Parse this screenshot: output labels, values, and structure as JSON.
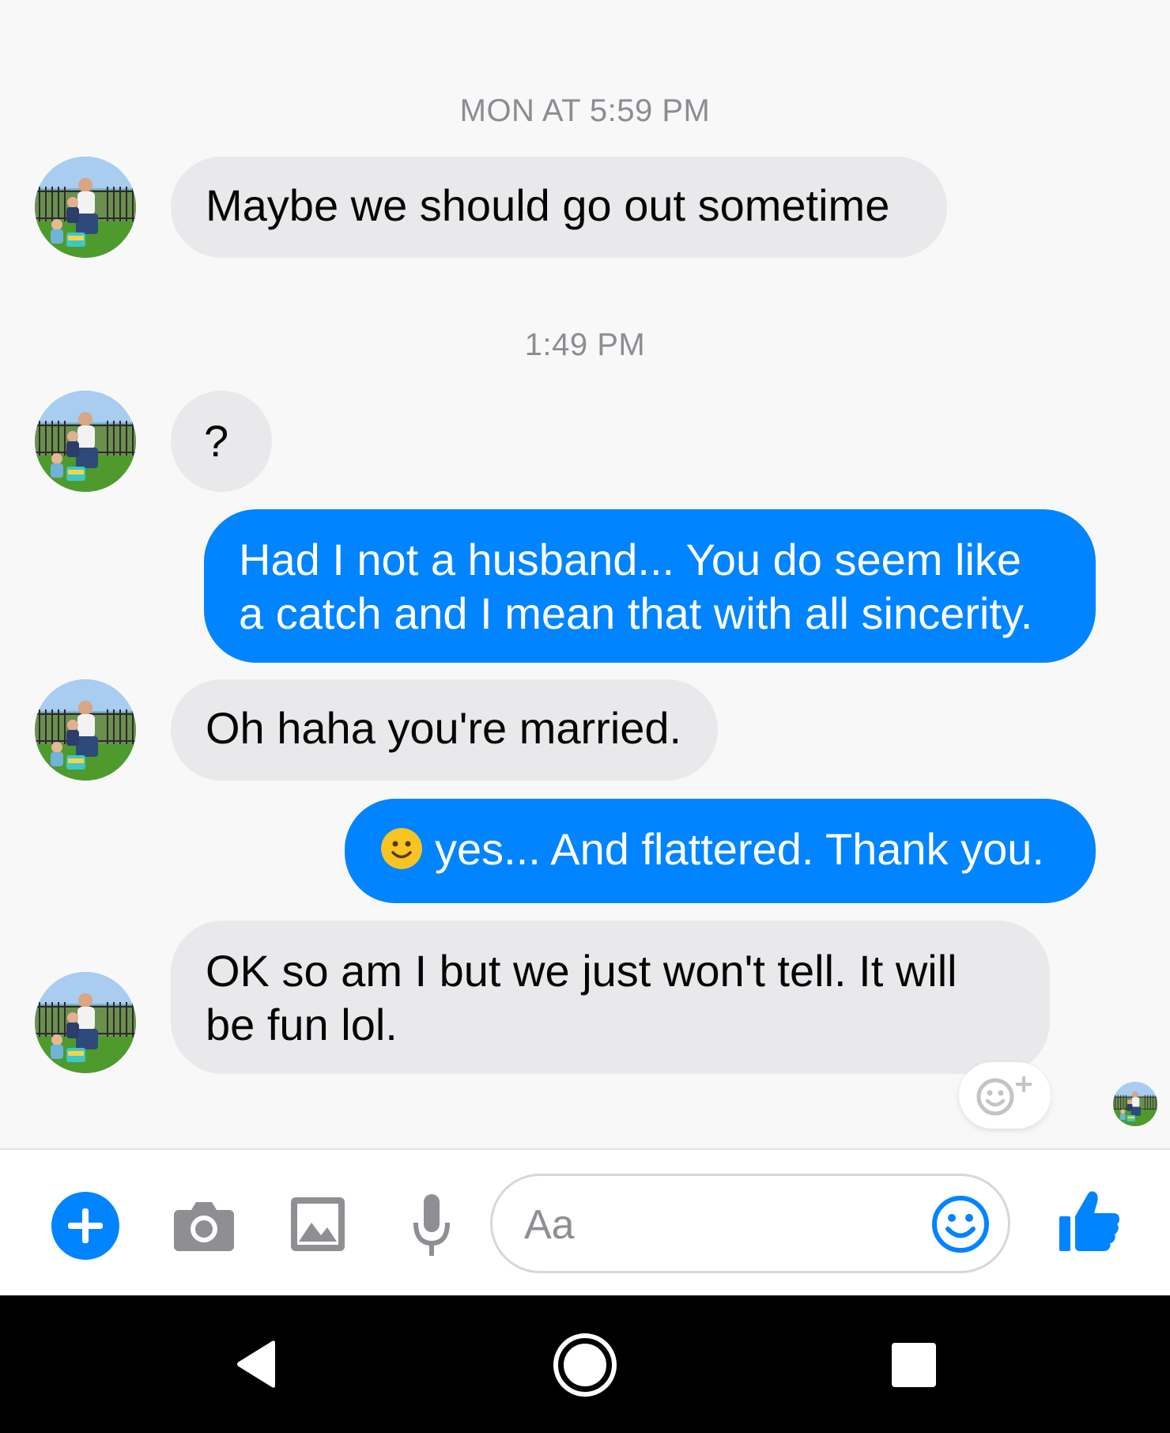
{
  "conversation": {
    "timestamps": [
      "MON AT 5:59 PM",
      "1:49 PM"
    ],
    "messages": [
      {
        "from": "them",
        "lines": [
          "Maybe we should go out sometime"
        ]
      },
      {
        "from": "them",
        "lines": [
          "?"
        ]
      },
      {
        "from": "me",
        "lines": [
          "Had I not a husband... You do seem like",
          "a catch and I mean that with all sincerity."
        ]
      },
      {
        "from": "them",
        "lines": [
          "Oh haha you're married."
        ]
      },
      {
        "from": "me",
        "emoji": "slightly-smiling-face-icon",
        "lines": [
          "yes... And flattered. Thank you."
        ]
      },
      {
        "from": "them",
        "lines": [
          "OK so am I but we just won't tell. It will",
          "be fun lol."
        ]
      }
    ]
  },
  "composer": {
    "placeholder": "Aa",
    "icons": [
      "plus-icon",
      "camera-icon",
      "gallery-icon",
      "microphone-icon",
      "emoji-icon",
      "thumbs-up-icon"
    ],
    "accent_color": "#0084ff"
  },
  "colors": {
    "outgoing_bubble": "#0084ff",
    "incoming_bubble": "#e9e9eb",
    "background": "#f8f8f9"
  },
  "navbar": {
    "icons": [
      "back-icon",
      "home-icon",
      "recents-icon"
    ]
  }
}
